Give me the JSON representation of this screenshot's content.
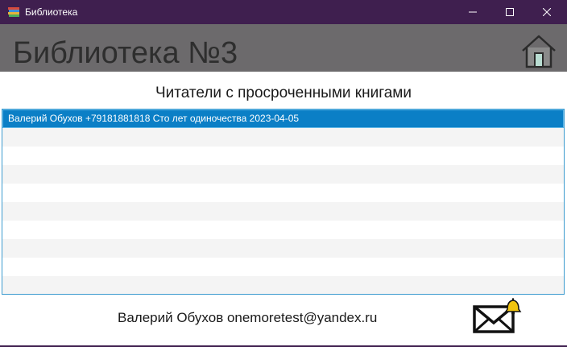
{
  "window": {
    "title": "Библиотека"
  },
  "header": {
    "title": "Библиотека №3"
  },
  "section": {
    "title": "Читатели с просроченными книгами"
  },
  "readers": [
    {
      "text": "Валерий Обухов +79181881818 Сто лет одиночества 2023-04-05",
      "selected": true
    }
  ],
  "footer": {
    "user": "Валерий Обухов onemoretest@yandex.ru"
  },
  "icons": {
    "app": "books-icon",
    "home": "home-icon",
    "mail": "mail-notification-icon",
    "minimize": "minimize-icon",
    "maximize": "maximize-icon",
    "close": "close-icon"
  },
  "colors": {
    "titlebar": "#3f1f4f",
    "header": "#6c6a6c",
    "selection": "#0b7fc6",
    "list_border": "#3c9bcf"
  }
}
